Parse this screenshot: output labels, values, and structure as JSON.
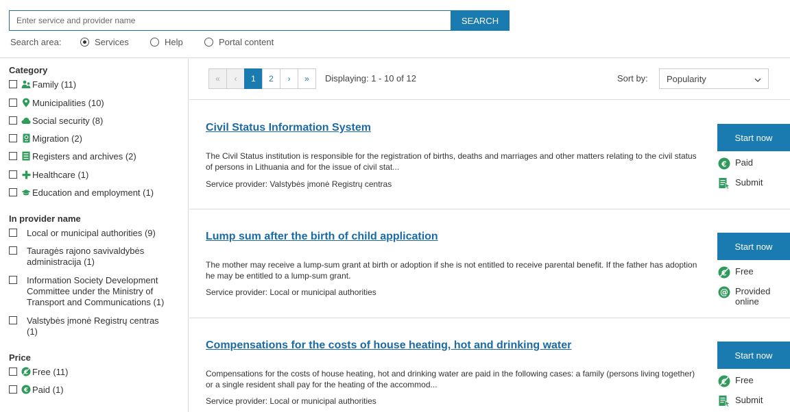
{
  "search": {
    "placeholder": "Enter service and provider name",
    "button_label": "SEARCH",
    "area_label": "Search area:",
    "options": [
      {
        "label": "Services",
        "checked": true
      },
      {
        "label": "Help",
        "checked": false
      },
      {
        "label": "Portal content",
        "checked": false
      }
    ]
  },
  "sidebar": {
    "category_heading": "Category",
    "categories": [
      {
        "label": "Family (11)",
        "icon": "family-icon"
      },
      {
        "label": "Municipalities (10)",
        "icon": "map-pin-icon"
      },
      {
        "label": "Social security (8)",
        "icon": "cloud-icon"
      },
      {
        "label": "Migration (2)",
        "icon": "passport-icon"
      },
      {
        "label": "Registers and archives (2)",
        "icon": "archive-icon"
      },
      {
        "label": "Healthcare (1)",
        "icon": "plus-icon"
      },
      {
        "label": "Education and employment (1)",
        "icon": "graduation-cap-icon"
      }
    ],
    "provider_heading": "In provider name",
    "providers": [
      {
        "label": "Local or municipal authorities (9)"
      },
      {
        "label": "Tauragės rajono savivaldybės administracija (1)"
      },
      {
        "label": "Information Society Development Committee under the Ministry of Transport and Communications (1)"
      },
      {
        "label": "Valstybės įmonė Registrų centras (1)"
      }
    ],
    "price_heading": "Price",
    "prices": [
      {
        "label": "Free (11)",
        "icon": "free-icon"
      },
      {
        "label": "Paid (1)",
        "icon": "euro-icon"
      }
    ]
  },
  "toolbar": {
    "pager": [
      "«",
      "‹",
      "1",
      "2",
      "›",
      "»"
    ],
    "current_page": "1",
    "displaying": "Displaying: 1 - 10 of 12",
    "sort_label": "Sort by:",
    "sort_value": "Popularity"
  },
  "results": [
    {
      "title": "Civil Status Information System",
      "description": "The Civil Status institution is responsible for the registration of births, deaths and marriages and other matters relating to the civil status of persons in Lithuania and for the issue of civil stat...",
      "provider": "Service provider: Valstybės įmonė Registrų centras",
      "button": "Start now",
      "meta": [
        {
          "label": "Paid",
          "icon": "euro-icon"
        },
        {
          "label": "Submit",
          "icon": "submit-document-icon"
        }
      ]
    },
    {
      "title": "Lump sum after the birth of child application",
      "description": "The mother may receive a lump-sum grant at birth or adoption if she is not entitled to receive parental benefit. If the father has adoption he may be entitled to a lump-sum grant.",
      "provider": "Service provider: Local or municipal authorities",
      "button": "Start now",
      "meta": [
        {
          "label": "Free",
          "icon": "free-icon"
        },
        {
          "label": "Provided online",
          "icon": "at-sign-icon"
        }
      ]
    },
    {
      "title": "Compensations for the costs of house heating, hot and drinking water",
      "description": "Compensations for the costs of house heating, hot and drinking water are paid in the following cases: a family (persons living together) or a single resident shall pay for the heating of the accommod...",
      "provider": "Service provider: Local or municipal authorities",
      "button": "Start now",
      "meta": [
        {
          "label": "Free",
          "icon": "free-icon"
        },
        {
          "label": "Submit",
          "icon": "submit-document-icon"
        }
      ]
    }
  ],
  "colors": {
    "accent": "#1a7bb0",
    "link": "#1a6aa5",
    "icon_green": "#2e9b5a"
  }
}
